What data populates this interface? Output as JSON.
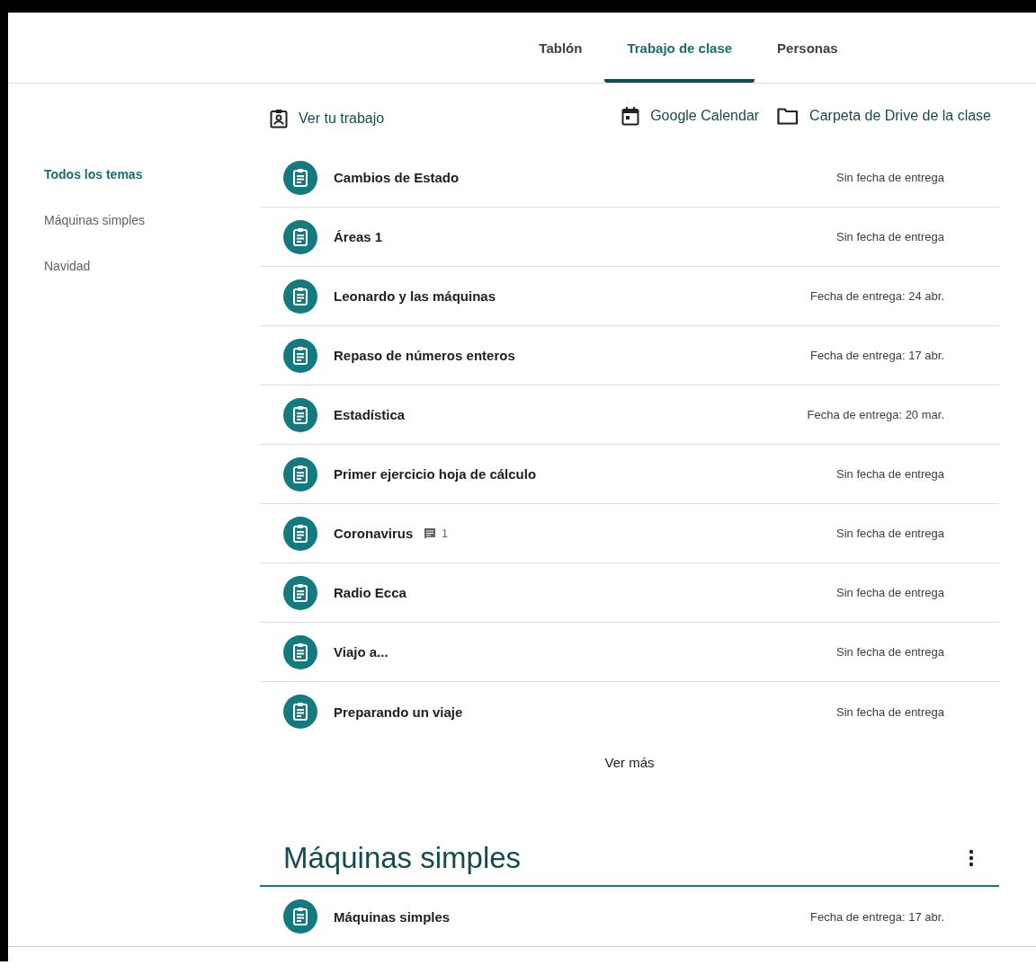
{
  "tabs": [
    {
      "label": "Tablón",
      "selected": false
    },
    {
      "label": "Trabajo de clase",
      "selected": true
    },
    {
      "label": "Personas",
      "selected": false
    }
  ],
  "toolbar": {
    "your_work": "Ver tu trabajo",
    "calendar": "Google Calendar",
    "drive_folder": "Carpeta de Drive de la clase"
  },
  "sidebar": {
    "items": [
      {
        "label": "Todos los temas",
        "selected": true
      },
      {
        "label": "Máquinas simples",
        "selected": false
      },
      {
        "label": "Navidad",
        "selected": false
      }
    ]
  },
  "assignments": [
    {
      "title": "Cambios de Estado",
      "due": "Sin fecha de entrega"
    },
    {
      "title": "Áreas 1",
      "due": "Sin fecha de entrega"
    },
    {
      "title": "Leonardo y las máquinas",
      "due": "Fecha de entrega: 24 abr."
    },
    {
      "title": "Repaso de números enteros",
      "due": "Fecha de entrega: 17 abr."
    },
    {
      "title": "Estadística",
      "due": "Fecha de entrega: 20 mar."
    },
    {
      "title": "Primer ejercicio hoja de cálculo",
      "due": "Sin fecha de entrega"
    },
    {
      "title": "Coronavirus",
      "comments": "1",
      "due": "Sin fecha de entrega"
    },
    {
      "title": "Radio Ecca",
      "due": "Sin fecha de entrega"
    },
    {
      "title": "Viajo a...",
      "due": "Sin fecha de entrega"
    },
    {
      "title": "Preparando un viaje",
      "due": "Sin fecha de entrega"
    }
  ],
  "view_more": "Ver más",
  "topics": [
    {
      "title": "Máquinas simples",
      "assignments": [
        {
          "title": "Máquinas simples",
          "due": "Fecha de entrega: 17 abr."
        }
      ]
    }
  ]
}
